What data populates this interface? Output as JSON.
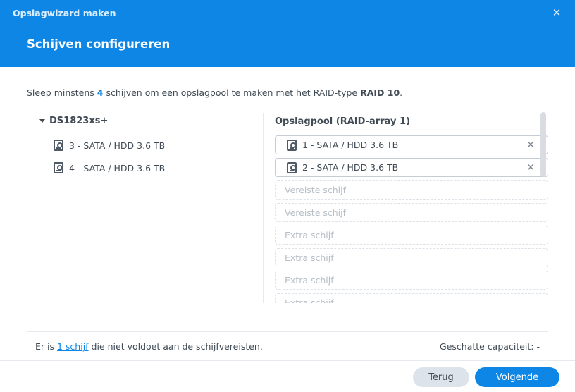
{
  "window": {
    "title": "Opslagwizard maken",
    "close_symbol": "✕"
  },
  "page": {
    "title": "Schijven configureren"
  },
  "instruction": {
    "prefix": "Sleep minstens ",
    "count": "4",
    "middle": " schijven om een opslagpool te maken met het RAID-type ",
    "raid_type": "RAID 10",
    "suffix": "."
  },
  "available": {
    "device_name": "DS1823xs+",
    "disks": [
      {
        "label": "3 - SATA / HDD 3.6 TB",
        "icon": "hdd-icon"
      },
      {
        "label": "4 - SATA / HDD 3.6 TB",
        "icon": "hdd-icon"
      }
    ]
  },
  "pool": {
    "title": "Opslagpool (RAID-array 1)",
    "remove_symbol": "✕",
    "slots": [
      {
        "type": "filled",
        "label": "1 - SATA / HDD 3.6 TB",
        "icon": "hdd-icon"
      },
      {
        "type": "filled",
        "label": "2 - SATA / HDD 3.6 TB",
        "icon": "hdd-icon"
      },
      {
        "type": "empty",
        "label": "Vereiste schijf"
      },
      {
        "type": "empty",
        "label": "Vereiste schijf"
      },
      {
        "type": "empty",
        "label": "Extra schijf"
      },
      {
        "type": "empty",
        "label": "Extra schijf"
      },
      {
        "type": "empty",
        "label": "Extra schijf"
      },
      {
        "type": "empty",
        "label": "Extra schijf"
      }
    ]
  },
  "footer": {
    "status_prefix": "Er is ",
    "status_link": "1 schijf",
    "status_suffix": " die niet voldoet aan de schijfvereisten.",
    "capacity_label": "Geschatte capaciteit:",
    "capacity_value": "-"
  },
  "buttons": {
    "back": "Terug",
    "next": "Volgende"
  },
  "colors": {
    "accent": "#0d86e6",
    "header_bg": "#0d86e6",
    "text": "#414b55",
    "placeholder_text": "#b7bec6"
  }
}
